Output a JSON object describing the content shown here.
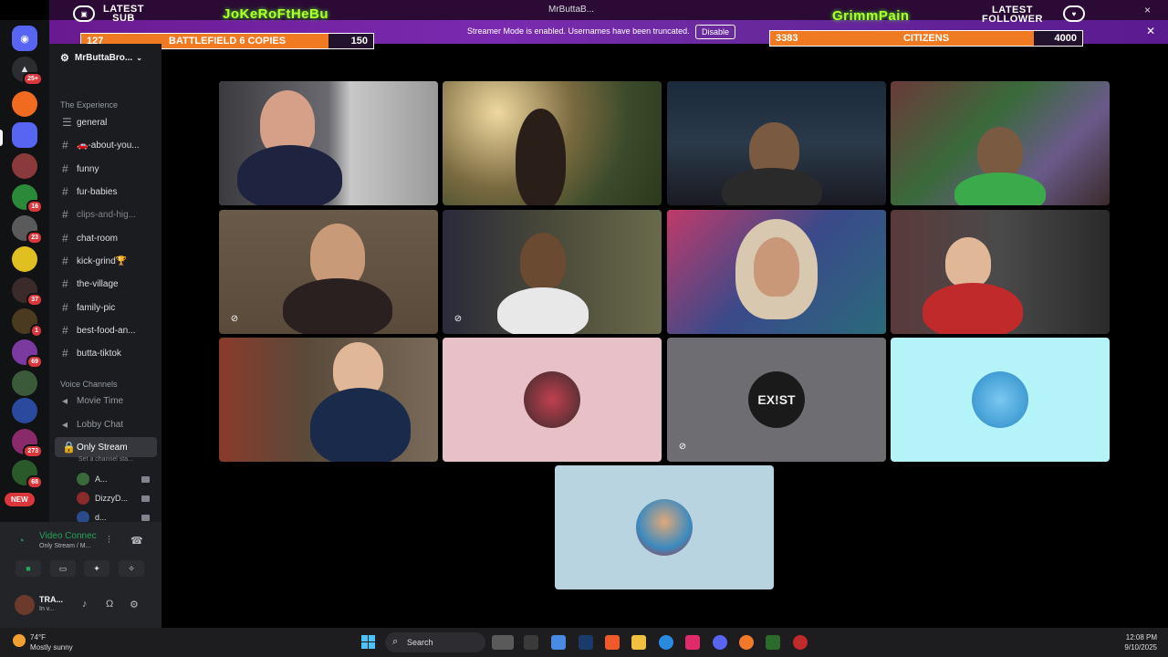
{
  "window": {
    "title": "MrButtaB...",
    "close_icon": "×"
  },
  "overlay": {
    "latest_sub_label": [
      "LATEST",
      "SUB"
    ],
    "latest_sub_name": "JoKeRoFtHeBu",
    "latest_follower_label": [
      "LATEST",
      "FOLLOWER"
    ],
    "latest_follower_name": "GrimmPain",
    "goal_left": {
      "current": "127",
      "label": "BATTLEFIELD 6 COPIES",
      "target": "150",
      "progress": 0.847
    },
    "goal_right": {
      "current": "3383",
      "label": "CITIZENS",
      "target": "4000",
      "progress": 0.846
    },
    "streamer_mode": "Streamer Mode is enabled. Usernames have been truncated.",
    "disable_label": "Disable",
    "close_label": "✕"
  },
  "rail": {
    "badges": [
      "25+",
      "16",
      "23",
      "37",
      "1",
      "69",
      "273",
      "68"
    ],
    "new_label": "NEW"
  },
  "server": {
    "name": "MrButtaBro...",
    "categories": {
      "experience": "The Experience",
      "voice": "Voice Channels"
    },
    "text_channels": [
      "general",
      "🚗-about-you...",
      "funny",
      "fur-babies",
      "clips-and-hig...",
      "chat-room",
      "kick-grind🏆",
      "the-village",
      "family-pic",
      "best-food-an...",
      "butta-tiktok"
    ],
    "voice_channels": [
      "Movie Time",
      "Lobby Chat",
      "Only Stream"
    ],
    "channel_status_placeholder": "Set a channel sta...",
    "voice_users": [
      "A...",
      "DizzyD...",
      "d..."
    ]
  },
  "voice_panel": {
    "status": "Video Connec",
    "location": "Only Stream / M..."
  },
  "user": {
    "name": "TRA...",
    "status": "In v..."
  },
  "taskbar": {
    "temp": "74°F",
    "weather": "Mostly sunny",
    "search_placeholder": "Search",
    "time": "12:08 PM",
    "date": "9/10/2025"
  },
  "colors": {
    "accent_purple": "#6a1a90",
    "speaking_green": "#6fc38a",
    "online_green": "#23a55a",
    "goal_orange": "#ef7a22"
  }
}
